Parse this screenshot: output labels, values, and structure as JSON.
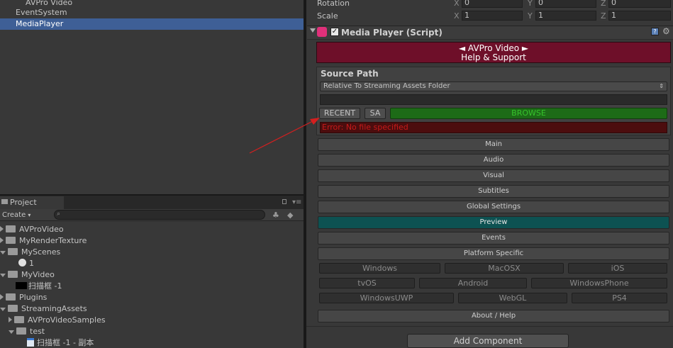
{
  "hierarchy": {
    "items": [
      "AVPro Video",
      "EventSystem",
      "MediaPlayer"
    ],
    "selected": "MediaPlayer"
  },
  "project": {
    "tab_label": "Project",
    "create_label": "Create",
    "search_placeholder": "",
    "items": [
      {
        "label": "AVProVideo",
        "type": "folder",
        "expanded": false
      },
      {
        "label": "MyRenderTexture",
        "type": "folder",
        "expanded": false
      },
      {
        "label": "MyScenes",
        "type": "folder",
        "expanded": true
      },
      {
        "label": "1",
        "type": "unity-scene"
      },
      {
        "label": "MyVideo",
        "type": "folder",
        "expanded": true
      },
      {
        "label": "扫描框 -1",
        "type": "video"
      },
      {
        "label": "Plugins",
        "type": "folder",
        "expanded": false
      },
      {
        "label": "StreamingAssets",
        "type": "folder",
        "expanded": true
      },
      {
        "label": "AVProVideoSamples",
        "type": "folder",
        "expanded": false
      },
      {
        "label": "test",
        "type": "folder",
        "expanded": true
      },
      {
        "label": "扫描框 -1 - 副本",
        "type": "file"
      }
    ]
  },
  "transform": {
    "rotation_label": "Rotation",
    "scale_label": "Scale",
    "axis_x": "X",
    "axis_y": "Y",
    "axis_z": "Z",
    "rotation": {
      "x": "0",
      "y": "0",
      "z": "0"
    },
    "scale": {
      "x": "1",
      "y": "1",
      "z": "1"
    }
  },
  "component": {
    "title": "Media Player (Script)",
    "enabled": true
  },
  "banner": {
    "line1": "◄ AVPro Video ►",
    "line2": "Help & Support"
  },
  "source": {
    "title": "Source Path",
    "dropdown_value": "Relative To Streaming Assets Folder",
    "path_value": "",
    "recent_label": "RECENT",
    "sa_label": "SA",
    "browse_label": "BROWSE",
    "error_text": "Error: No file specified"
  },
  "sections": [
    "Main",
    "Audio",
    "Visual",
    "Subtitles",
    "Global Settings",
    "Preview",
    "Events",
    "Platform Specific"
  ],
  "active_section": "Preview",
  "platforms": [
    "Windows",
    "MacOSX",
    "iOS",
    "tvOS",
    "Android",
    "WindowsPhone",
    "WindowsUWP",
    "WebGL",
    "PS4"
  ],
  "about_label": "About / Help",
  "add_component_label": "Add Component",
  "colors": {
    "selection": "#3e5f96",
    "banner": "#6e0f29",
    "browse": "#1d6b17",
    "browse_text": "#36c42c",
    "error_bg": "#4c0d0e",
    "error_text": "#c71a1a",
    "preview_active": "#0d5252",
    "annotation_arrow": "#d41f1f"
  }
}
